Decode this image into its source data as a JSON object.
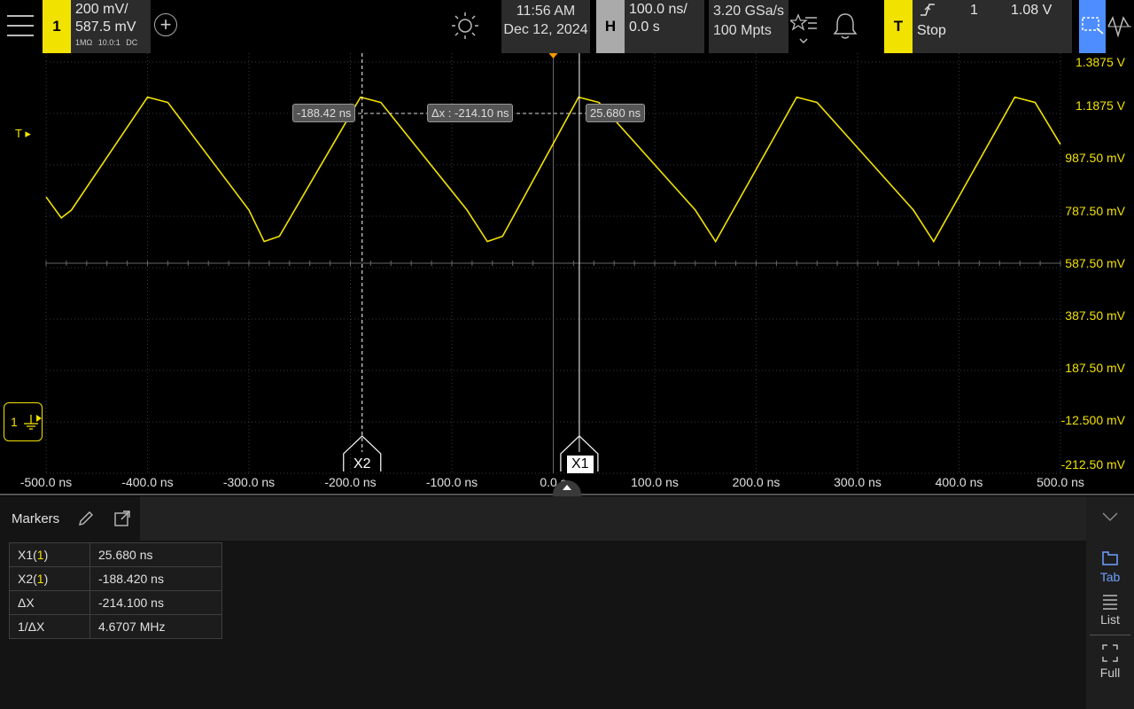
{
  "channel1": {
    "number": "1",
    "scale": "200 mV/",
    "offset": "587.5 mV",
    "impedance": "1MΩ",
    "probe": "10.0:1",
    "coupling": "DC",
    "color": "#f2e200",
    "ground_label": "1"
  },
  "header": {
    "menu_icon": "hamburger-icon",
    "add_icon": "plus-circle-icon",
    "brightness_icon": "sun-icon",
    "time": "11:56 AM",
    "date": "Dec 12, 2024",
    "favorites_icon": "star-list-icon",
    "notifications_icon": "bell-icon"
  },
  "horizontal": {
    "tab": "H",
    "scale": "100.0 ns/",
    "delay": "0.0 s"
  },
  "acquisition": {
    "sample_rate": "3.20 GSa/s",
    "memory_depth": "100 Mpts"
  },
  "trigger": {
    "tab": "T",
    "edge_icon": "rising-edge-icon",
    "source": "1",
    "level": "1.08 V",
    "status": "Stop",
    "marker_label": "T"
  },
  "toolbar_right": {
    "zoom_icon": "zoom-box-icon",
    "waveform_icon": "waveform-icon"
  },
  "plot": {
    "y_labels": [
      "1.3875 V",
      "1.1875 V",
      "987.50 mV",
      "787.50 mV",
      "587.50 mV",
      "387.50 mV",
      "187.50 mV",
      "-12.500 mV",
      "-212.50 mV"
    ],
    "x_labels": [
      "-500.0 ns",
      "-400.0 ns",
      "-300.0 ns",
      "-200.0 ns",
      "-100.0 ns",
      "0.0 s",
      "100.0 ns",
      "200.0 ns",
      "300.0 ns",
      "400.0 ns",
      "500.0 ns"
    ],
    "marker_x1_label": "X1",
    "marker_x2_label": "X2",
    "readout_x2": "-188.42 ns",
    "readout_dx": "Δx : -214.10 ns",
    "readout_x1": "25.680 ns"
  },
  "chart_data": {
    "type": "line",
    "xlabel": "",
    "ylabel": "",
    "xlim": [
      -500,
      500
    ],
    "x_unit": "ns",
    "ylim": [
      -0.2125,
      1.3875
    ],
    "y_unit": "V",
    "grid": true,
    "series": [
      {
        "color": "#f2e200",
        "x": [
          -500,
          -485,
          -475,
          -400,
          -380,
          -300,
          -285,
          -270,
          -190,
          -170,
          -85,
          -65,
          -50,
          25,
          45,
          140,
          160,
          240,
          260,
          355,
          375,
          455,
          475,
          500
        ],
        "y": [
          0.84,
          0.76,
          0.79,
          1.22,
          1.2,
          0.79,
          0.67,
          0.69,
          1.22,
          1.2,
          0.79,
          0.67,
          0.69,
          1.22,
          1.2,
          0.79,
          0.67,
          1.22,
          1.2,
          0.79,
          0.67,
          1.22,
          1.2,
          1.04
        ]
      }
    ],
    "markers": {
      "X1": 25.68,
      "X2": -188.42
    }
  },
  "bottom_panel": {
    "tab_label": "Markers",
    "edit_icon": "pencil-icon",
    "popout_icon": "popout-icon",
    "collapse_icon": "chevron-down-icon",
    "rows": [
      {
        "name": "X1(",
        "channel": "1",
        "close": ")",
        "value": "25.680 ns"
      },
      {
        "name": "X2(",
        "channel": "1",
        "close": ")",
        "value": "-188.420 ns"
      },
      {
        "name": "ΔX",
        "channel": "",
        "close": "",
        "value": "-214.100 ns"
      },
      {
        "name": "1/ΔX",
        "channel": "",
        "close": "",
        "value": "4.6707 MHz"
      }
    ],
    "side_tab": "Tab",
    "side_list": "List",
    "side_full": "Full"
  }
}
